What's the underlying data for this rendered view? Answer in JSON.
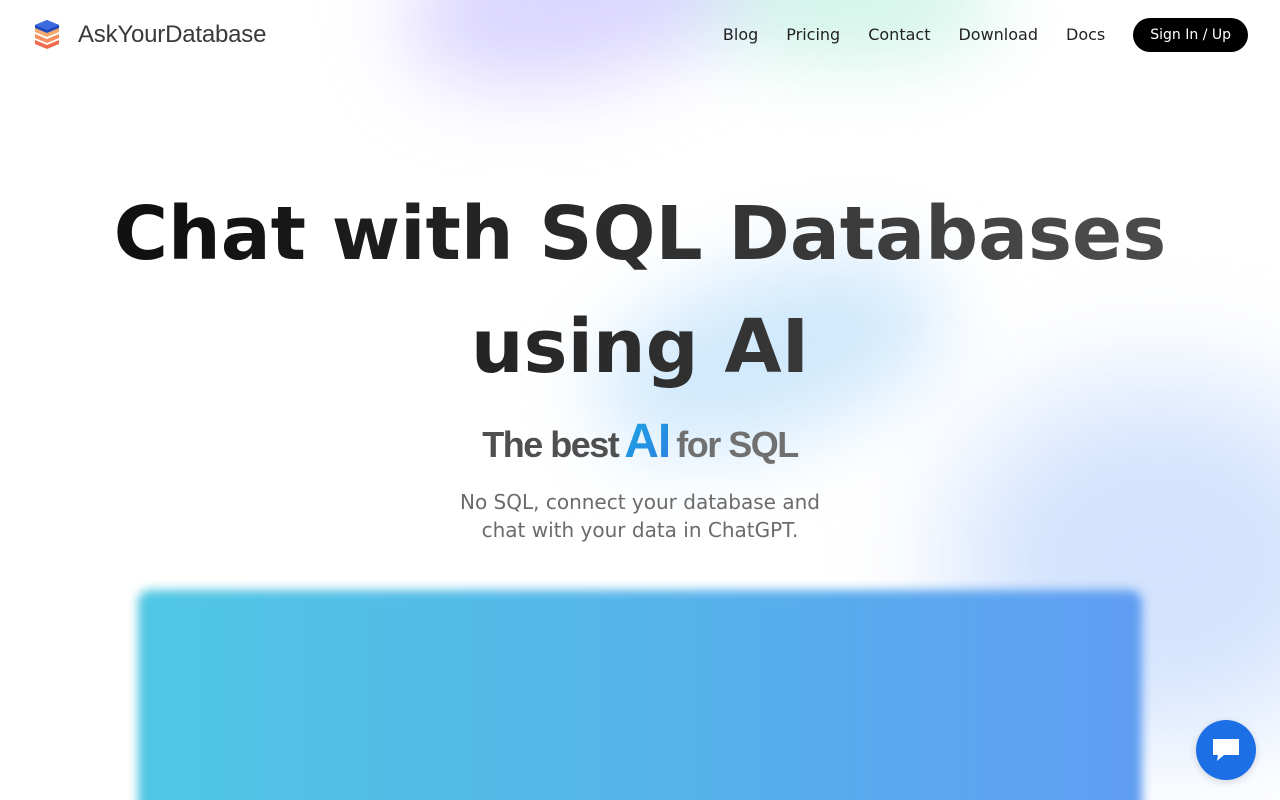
{
  "brand": {
    "name": "AskYourDatabase",
    "logo_icon": "stacked-database-icon"
  },
  "nav": {
    "links": [
      "Blog",
      "Pricing",
      "Contact",
      "Download",
      "Docs"
    ],
    "signin_label": "Sign In / Up"
  },
  "hero": {
    "title_line1": "Chat with SQL Databases",
    "title_line2": "using AI",
    "tagline_pre": "The best",
    "tagline_ai": "AI",
    "tagline_post": "for SQL",
    "subtitle_line1": "No SQL, connect your database and",
    "subtitle_line2": "chat with your data in ChatGPT."
  },
  "chat_widget": {
    "icon": "chat-bubble-icon"
  },
  "colors": {
    "accent": "#1d6fe6",
    "button_dark": "#000000",
    "ai_gradient_start": "#1fa6e6",
    "ai_gradient_end": "#2b7fe0"
  }
}
